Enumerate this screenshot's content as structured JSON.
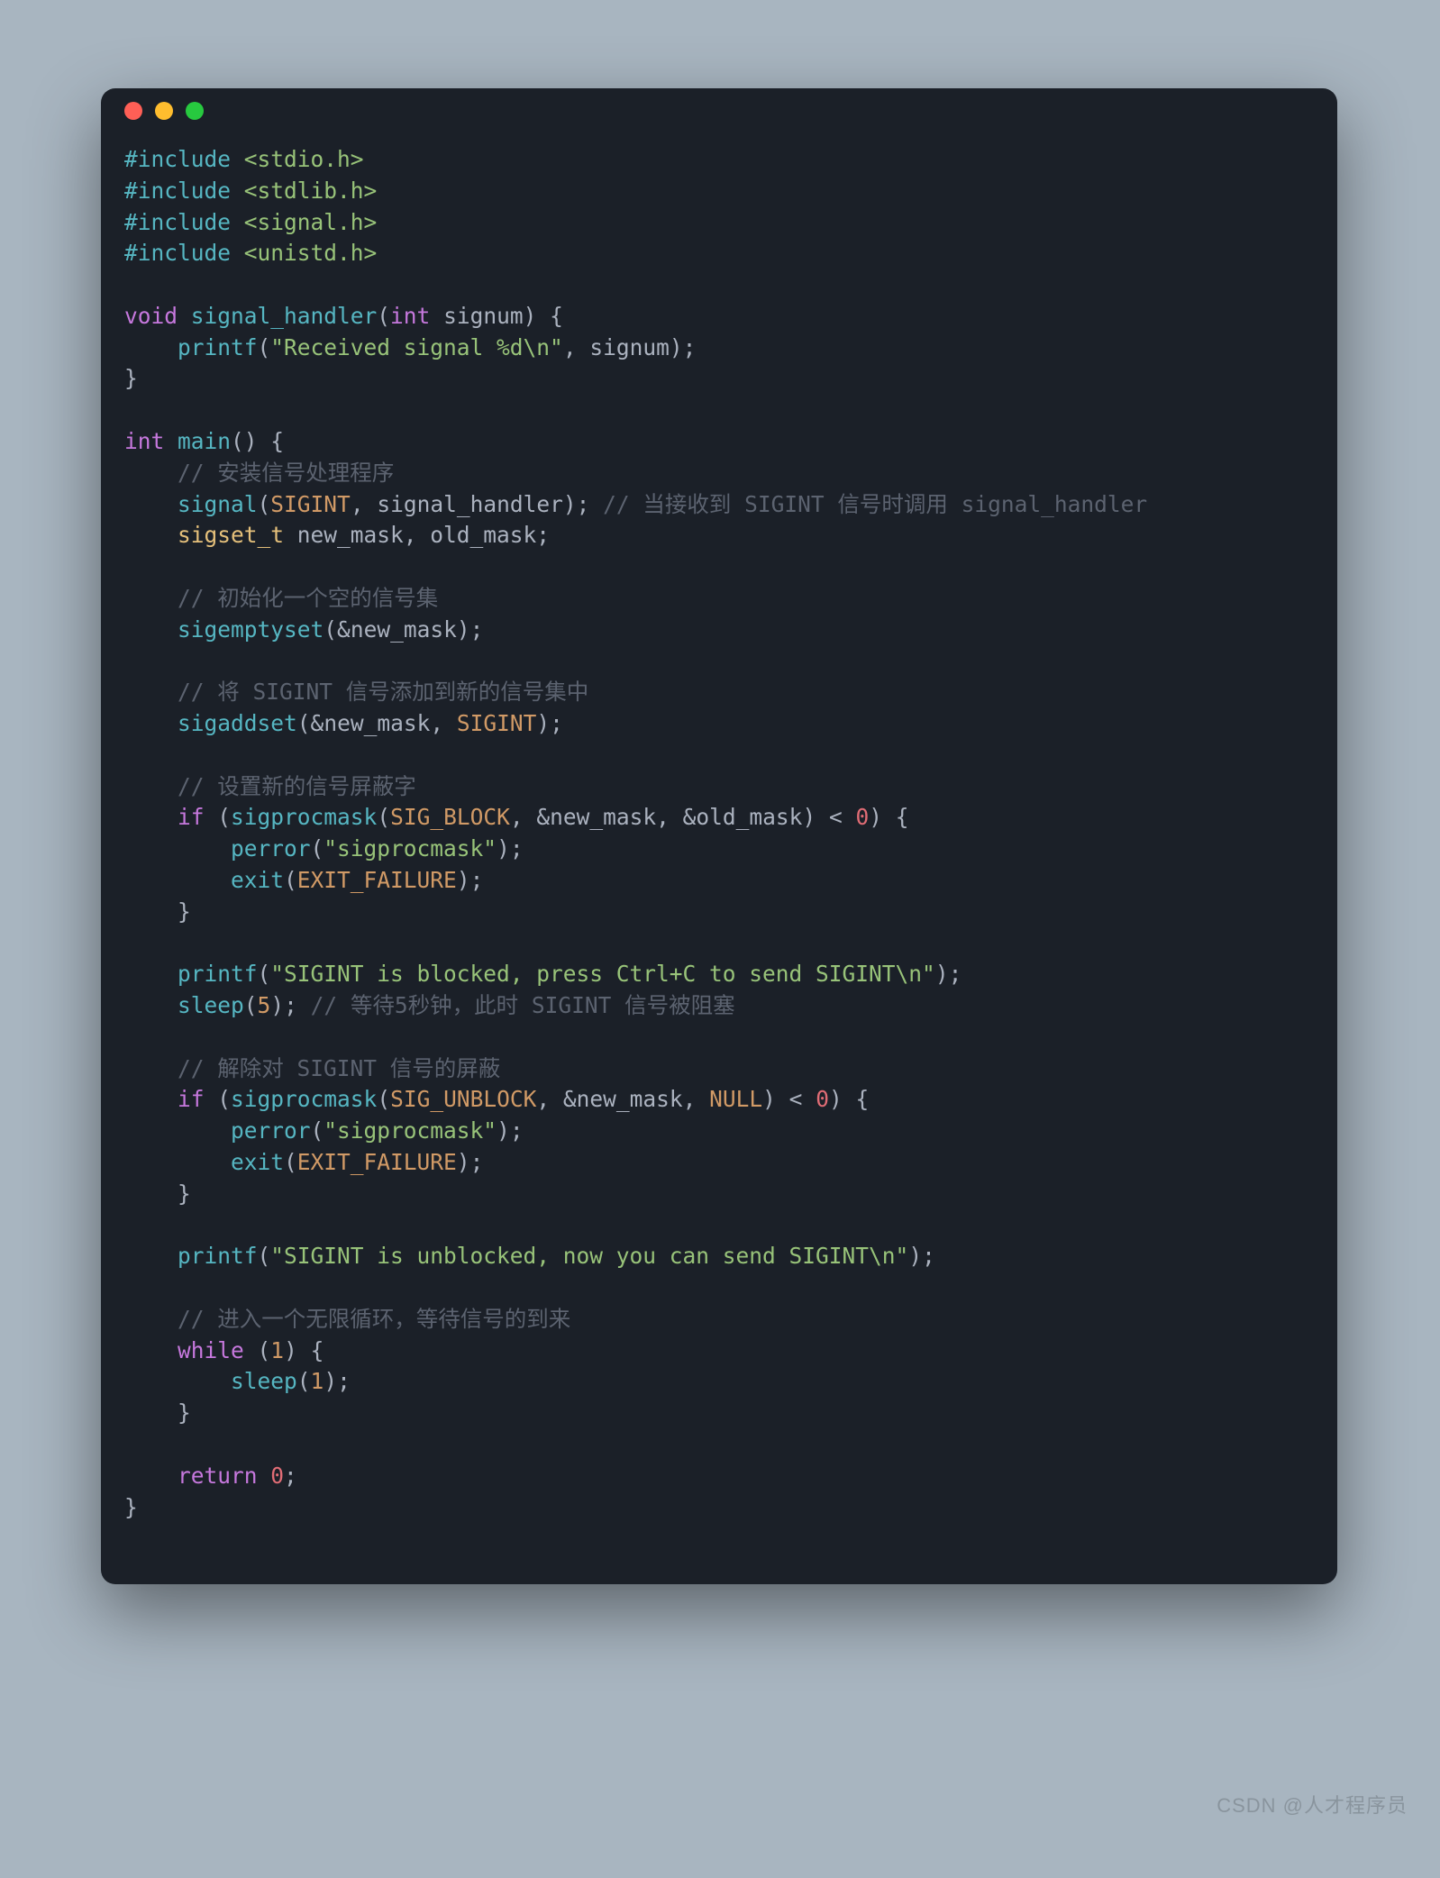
{
  "window": {
    "dots": [
      "red",
      "yellow",
      "green"
    ]
  },
  "code": {
    "l1_pre": "#include",
    "l1_inc": " <stdio.h>",
    "l2_pre": "#include",
    "l2_inc": " <stdlib.h>",
    "l3_pre": "#include",
    "l3_inc": " <signal.h>",
    "l4_pre": "#include",
    "l4_inc": " <unistd.h>",
    "blank": "",
    "l6_kw": "void",
    "l6_fn": " signal_handler",
    "l6_op1": "(",
    "l6_typ": "int",
    "l6_arg": " signum",
    "l6_op2": ") {",
    "l7_indent": "    ",
    "l7_fn": "printf",
    "l7_op1": "(",
    "l7_str": "\"Received signal %d\\n\"",
    "l7_comma": ", ",
    "l7_arg": "signum",
    "l7_op2": ");",
    "l8": "}",
    "l10_typ": "int",
    "l10_fn": " main",
    "l10_op1": "() {",
    "l11_indent": "    ",
    "l11_cmt": "// 安装信号处理程序",
    "l12_indent": "    ",
    "l12_fn": "signal",
    "l12_op1": "(",
    "l12_const": "SIGINT",
    "l12_comma": ", ",
    "l12_arg": "signal_handler",
    "l12_op2": "); ",
    "l12_cmt": "// 当接收到 SIGINT 信号时调用 signal_handler",
    "l13_indent": "    ",
    "l13_typ": "sigset_t",
    "l13_vars": " new_mask, old_mask;",
    "l15_indent": "    ",
    "l15_cmt": "// 初始化一个空的信号集",
    "l16_indent": "    ",
    "l16_fn": "sigemptyset",
    "l16_op1": "(",
    "l16_amp": "&",
    "l16_arg": "new_mask",
    "l16_op2": ");",
    "l18_indent": "    ",
    "l18_cmt": "// 将 SIGINT 信号添加到新的信号集中",
    "l19_indent": "    ",
    "l19_fn": "sigaddset",
    "l19_op1": "(",
    "l19_amp": "&",
    "l19_arg": "new_mask",
    "l19_comma": ", ",
    "l19_const": "SIGINT",
    "l19_op2": ");",
    "l21_indent": "    ",
    "l21_cmt": "// 设置新的信号屏蔽字",
    "l22_indent": "    ",
    "l22_kw": "if ",
    "l22_op1": "(",
    "l22_fn": "sigprocmask",
    "l22_op2": "(",
    "l22_const": "SIG_BLOCK",
    "l22_c1": ", ",
    "l22_amp1": "&",
    "l22_a1": "new_mask",
    "l22_c2": ", ",
    "l22_amp2": "&",
    "l22_a2": "old_mask",
    "l22_op3": ") < ",
    "l22_zero": "0",
    "l22_op4": ") {",
    "l23_indent": "        ",
    "l23_fn": "perror",
    "l23_op1": "(",
    "l23_str": "\"sigprocmask\"",
    "l23_op2": ");",
    "l24_indent": "        ",
    "l24_fn": "exit",
    "l24_op1": "(",
    "l24_const": "EXIT_FAILURE",
    "l24_op2": ");",
    "l25_indent": "    ",
    "l25": "}",
    "l27_indent": "    ",
    "l27_fn": "printf",
    "l27_op1": "(",
    "l27_str": "\"SIGINT is blocked, press Ctrl+C to send SIGINT\\n\"",
    "l27_op2": ");",
    "l28_indent": "    ",
    "l28_fn": "sleep",
    "l28_op1": "(",
    "l28_num": "5",
    "l28_op2": "); ",
    "l28_cmt": "// 等待5秒钟，此时 SIGINT 信号被阻塞",
    "l30_indent": "    ",
    "l30_cmt": "// 解除对 SIGINT 信号的屏蔽",
    "l31_indent": "    ",
    "l31_kw": "if ",
    "l31_op1": "(",
    "l31_fn": "sigprocmask",
    "l31_op2": "(",
    "l31_const": "SIG_UNBLOCK",
    "l31_c1": ", ",
    "l31_amp": "&",
    "l31_a1": "new_mask",
    "l31_c2": ", ",
    "l31_null": "NULL",
    "l31_op3": ") < ",
    "l31_zero": "0",
    "l31_op4": ") {",
    "l32_indent": "        ",
    "l32_fn": "perror",
    "l32_op1": "(",
    "l32_str": "\"sigprocmask\"",
    "l32_op2": ");",
    "l33_indent": "        ",
    "l33_fn": "exit",
    "l33_op1": "(",
    "l33_const": "EXIT_FAILURE",
    "l33_op2": ");",
    "l34_indent": "    ",
    "l34": "}",
    "l36_indent": "    ",
    "l36_fn": "printf",
    "l36_op1": "(",
    "l36_str": "\"SIGINT is unblocked, now you can send SIGINT\\n\"",
    "l36_op2": ");",
    "l38_indent": "    ",
    "l38_cmt": "// 进入一个无限循环，等待信号的到来",
    "l39_indent": "    ",
    "l39_kw": "while ",
    "l39_op1": "(",
    "l39_num": "1",
    "l39_op2": ") {",
    "l40_indent": "        ",
    "l40_fn": "sleep",
    "l40_op1": "(",
    "l40_num": "1",
    "l40_op2": ");",
    "l41_indent": "    ",
    "l41": "}",
    "l43_indent": "    ",
    "l43_kw": "return ",
    "l43_zero": "0",
    "l43_op": ";",
    "l44": "}"
  },
  "watermark": "CSDN @人才程序员"
}
